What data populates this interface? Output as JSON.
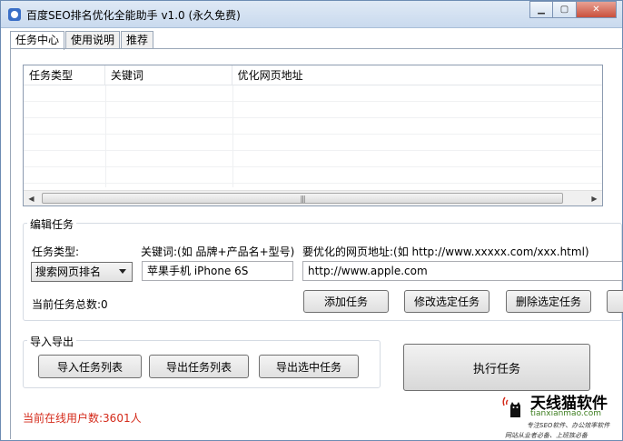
{
  "window": {
    "title": "百度SEO排名优化全能助手 v1.0 (永久免费)",
    "controls": {
      "minimize": "▁",
      "maximize": "▢",
      "close": "✕"
    }
  },
  "tabs": [
    {
      "label": "任务中心",
      "active": true
    },
    {
      "label": "使用说明",
      "active": false
    },
    {
      "label": "推荐",
      "active": false
    }
  ],
  "task_list": {
    "columns": [
      "任务类型",
      "关键词",
      "优化网页地址"
    ],
    "rows": [],
    "scroll_grip": "|||"
  },
  "edit_task": {
    "group_title": "编辑任务",
    "type_label": "任务类型:",
    "type_value": "搜索网页排名",
    "keyword_label": "关键词:(如 品牌+产品名+型号)",
    "keyword_value": "苹果手机 iPhone 6S",
    "url_label": "要优化的网页地址:(如 http://www.xxxxx.com/xxx.html)",
    "url_value": "http://www.apple.com",
    "total_label": "当前任务总数:0",
    "add_button": "添加任务",
    "modify_button": "修改选定任务",
    "delete_button": "删除选定任务"
  },
  "import_export": {
    "group_title": "导入导出",
    "import_button": "导入任务列表",
    "export_button": "导出任务列表",
    "export_selected_button": "导出选中任务"
  },
  "execute_button": "执行任务",
  "status": {
    "online_users": "当前在线用户数:3601人"
  },
  "watermark": {
    "brand": "天线猫软件",
    "url": "tianxianmao.com",
    "slogan1": "专注SEO软件、办公效率软件",
    "slogan2": "网站从业者必备、上班族必备"
  },
  "colors": {
    "status_text": "#d42a1a",
    "title_bar": "#c9daee",
    "watermark_green": "#3c7d1e"
  }
}
